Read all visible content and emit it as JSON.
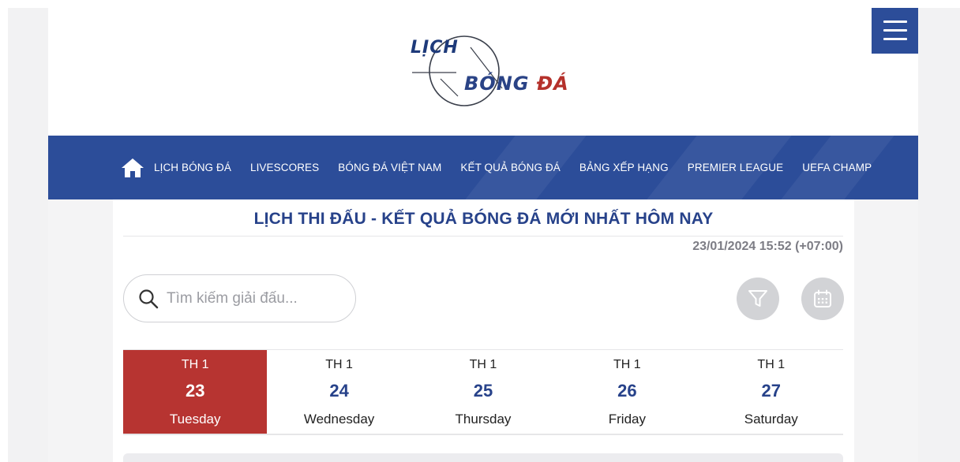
{
  "header": {
    "logo": {
      "line1": "LỊCH",
      "line2_word1": "BÓNG",
      "line2_word2": "ĐÁ"
    },
    "menu_icon": "hamburger-menu-icon"
  },
  "nav": {
    "home_icon": "home-icon",
    "items": [
      {
        "label": "LỊCH BÓNG ĐÁ"
      },
      {
        "label": "LIVESCORES"
      },
      {
        "label": "BÓNG ĐÁ VIỆT NAM"
      },
      {
        "label": "KẾT QUẢ BÓNG ĐÁ"
      },
      {
        "label": "BẢNG XẾP HẠNG"
      },
      {
        "label": "PREMIER LEAGUE"
      },
      {
        "label": "UEFA CHAMP"
      }
    ]
  },
  "main": {
    "title": "LỊCH THI ĐẤU - KẾT QUẢ BÓNG ĐÁ MỚI NHẤT HÔM NAY",
    "timestamp": "23/01/2024 15:52 (+07:00)",
    "search": {
      "placeholder": "Tìm kiếm giải đấu...",
      "value": "",
      "icon": "search-icon"
    },
    "filter_icon": "filter-icon",
    "calendar_icon": "calendar-icon",
    "dates": [
      {
        "month": "TH 1",
        "day": "23",
        "weekday": "Tuesday",
        "active": true
      },
      {
        "month": "TH 1",
        "day": "24",
        "weekday": "Wednesday",
        "active": false
      },
      {
        "month": "TH 1",
        "day": "25",
        "weekday": "Thursday",
        "active": false
      },
      {
        "month": "TH 1",
        "day": "26",
        "weekday": "Friday",
        "active": false
      },
      {
        "month": "TH 1",
        "day": "27",
        "weekday": "Saturday",
        "active": false
      }
    ]
  },
  "colors": {
    "brand_blue": "#2c4d99",
    "title_blue": "#27428a",
    "active_red": "#b73431"
  }
}
